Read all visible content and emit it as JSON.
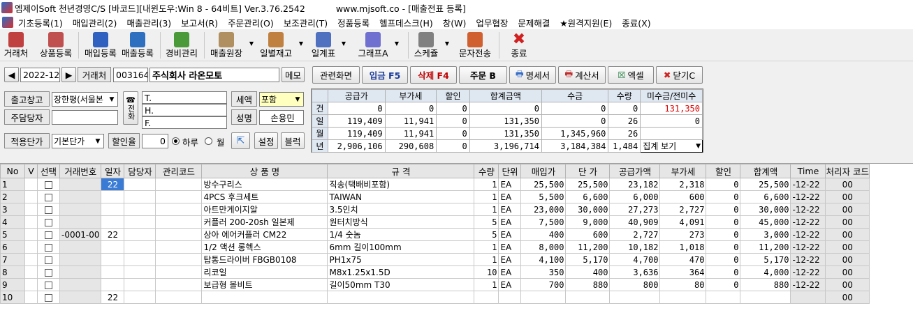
{
  "window": {
    "title": "엠제이Soft 천년경영C/S [바코드][내윈도우:Win 8 - 64비트] Ver.3.76.2542",
    "subtitle": "www.mjsoft.co - [매출전표 등록]"
  },
  "menu": [
    "기초등록(1)",
    "매입관리(2)",
    "매출관리(3)",
    "보고서(R)",
    "주문관리(O)",
    "보조관리(T)",
    "정품등록",
    "헬프데스크(H)",
    "창(W)",
    "업무협장",
    "문제해결",
    "★원격지원(E)",
    "종료(X)"
  ],
  "toolbar": [
    {
      "label": "거래처",
      "icon": "customer-icon",
      "color": "#c04040"
    },
    {
      "label": "상품등록",
      "icon": "product-icon",
      "color": "#c05050"
    },
    {
      "label": "매입등록",
      "icon": "purchase-icon",
      "color": "#3060c0"
    },
    {
      "label": "매출등록",
      "icon": "sales-icon",
      "color": "#2f6fc0"
    },
    {
      "label": "경비관리",
      "icon": "expense-icon",
      "color": "#4a9a3a"
    },
    {
      "label": "매출원장",
      "icon": "ledger-icon",
      "color": "#b09060"
    },
    {
      "label": "일별재고",
      "icon": "calendar-icon",
      "color": "#c08040"
    },
    {
      "label": "일계표",
      "icon": "daily-report-icon",
      "color": "#5070c0"
    },
    {
      "label": "그래프A",
      "icon": "graph-icon",
      "color": "#7070d0"
    },
    {
      "label": "스케쥴",
      "icon": "schedule-icon",
      "color": "#808080"
    },
    {
      "label": "문자전송",
      "icon": "sms-icon",
      "color": "#d06030"
    },
    {
      "label": "종료",
      "icon": "exit-icon",
      "color": "#d02020"
    }
  ],
  "header": {
    "prev": "◀",
    "next": "▶",
    "period": "2022-12",
    "customer_label": "거래처",
    "customer_code": "003164",
    "customer_name": "주식회사 라온모토",
    "memo": "메모",
    "warehouse_label": "출고창고",
    "warehouse_value": "장한평(서울본",
    "manager_label": "주담당자",
    "manager_value": "",
    "phone_label": "전화",
    "phone_t": "T.",
    "phone_h": "H.",
    "phone_f": "F.",
    "tax_label": "세액",
    "tax_value": "포함",
    "name_label": "성명",
    "name_value": "손용민",
    "price_label": "적용단가",
    "price_value": "기본단가",
    "discount_label": "할인율",
    "discount_value": "0",
    "radio_day": "하루",
    "radio_month": "월",
    "settings": "설정",
    "block": "블럭"
  },
  "actions": {
    "related": "관련화면",
    "entry": "입금 F5",
    "delete": "삭제 F4",
    "order": "주문 B",
    "statement": "명세서",
    "invoice": "계산서",
    "excel": "엑셀",
    "close": "닫기C"
  },
  "summary": {
    "columns": [
      "",
      "공급가",
      "부가세",
      "할인",
      "합계금액",
      "수금",
      "수량",
      "미수금/전미수"
    ],
    "rows": [
      {
        "label": "건",
        "values": [
          "0",
          "0",
          "0",
          "0",
          "0",
          "0",
          "131,350"
        ]
      },
      {
        "label": "일",
        "values": [
          "119,409",
          "11,941",
          "0",
          "131,350",
          "0",
          "26",
          "0"
        ]
      },
      {
        "label": "월",
        "values": [
          "119,409",
          "11,941",
          "0",
          "131,350",
          "1,345,960",
          "26",
          ""
        ]
      },
      {
        "label": "년",
        "values": [
          "2,906,106",
          "290,608",
          "0",
          "3,196,714",
          "3,184,384",
          "1,484",
          ""
        ]
      }
    ],
    "view_option": "집계 보기",
    "red_color": "#e00000"
  },
  "grid": {
    "columns": [
      "No",
      "V",
      "선택",
      "거래번호",
      "일자",
      "담당자",
      "관리코드",
      "상 품 명",
      "규 격",
      "수량",
      "단위",
      "매입가",
      "단 가",
      "공급가액",
      "부가세",
      "할인",
      "합계액",
      "Time",
      "처리자 코드"
    ],
    "trade_no": "-0001-00",
    "rows": [
      {
        "no": "1",
        "day": "22",
        "name": "방수구리스",
        "spec": "직송(택배비포함)",
        "qty": "1",
        "unit": "EA",
        "cost": "25,500",
        "price": "25,500",
        "supply": "23,182",
        "vat": "2,318",
        "disc": "0",
        "total": "25,500",
        "time": "-12-22",
        "user": "00"
      },
      {
        "no": "2",
        "day": "",
        "name": "4PCS 후크세트",
        "spec": "TAIWAN",
        "qty": "1",
        "unit": "EA",
        "cost": "5,500",
        "price": "6,600",
        "supply": "6,000",
        "vat": "600",
        "disc": "0",
        "total": "6,600",
        "time": "-12-22",
        "user": "00"
      },
      {
        "no": "3",
        "day": "",
        "name": "아트만게이지알",
        "spec": "3.5인치",
        "qty": "1",
        "unit": "EA",
        "cost": "23,000",
        "price": "30,000",
        "supply": "27,273",
        "vat": "2,727",
        "disc": "0",
        "total": "30,000",
        "time": "-12-22",
        "user": "00"
      },
      {
        "no": "4",
        "day": "",
        "name": "커플러 200-20sh 일본제",
        "spec": "원터치방식",
        "qty": "5",
        "unit": "EA",
        "cost": "7,500",
        "price": "9,000",
        "supply": "40,909",
        "vat": "4,091",
        "disc": "0",
        "total": "45,000",
        "time": "-12-22",
        "user": "00"
      },
      {
        "no": "5",
        "day": "22",
        "name": "상아 에어커플러 CM22",
        "spec": "1/4 숫놈",
        "qty": "5",
        "unit": "EA",
        "cost": "400",
        "price": "600",
        "supply": "2,727",
        "vat": "273",
        "disc": "0",
        "total": "3,000",
        "time": "-12-22",
        "user": "00"
      },
      {
        "no": "6",
        "day": "",
        "name": "1/2 액션 롱헥스",
        "spec": "6mm 길이100mm",
        "qty": "1",
        "unit": "EA",
        "cost": "8,000",
        "price": "11,200",
        "supply": "10,182",
        "vat": "1,018",
        "disc": "0",
        "total": "11,200",
        "time": "-12-22",
        "user": "00"
      },
      {
        "no": "7",
        "day": "",
        "name": "탑통드라이버 FBGB0108",
        "spec": "PH1x75",
        "qty": "1",
        "unit": "EA",
        "cost": "4,100",
        "price": "5,170",
        "supply": "4,700",
        "vat": "470",
        "disc": "0",
        "total": "5,170",
        "time": "-12-22",
        "user": "00"
      },
      {
        "no": "8",
        "day": "",
        "name": "리코일",
        "spec": "M8x1.25x1.5D",
        "qty": "10",
        "unit": "EA",
        "cost": "350",
        "price": "400",
        "supply": "3,636",
        "vat": "364",
        "disc": "0",
        "total": "4,000",
        "time": "-12-22",
        "user": "00"
      },
      {
        "no": "9",
        "day": "",
        "name": "보급형 볼비트",
        "spec": "길이50mm T30",
        "qty": "1",
        "unit": "EA",
        "cost": "700",
        "price": "880",
        "supply": "800",
        "vat": "80",
        "disc": "0",
        "total": "880",
        "time": "-12-22",
        "user": "00"
      },
      {
        "no": "10",
        "day": "22",
        "name": "",
        "spec": "",
        "qty": "",
        "unit": "",
        "cost": "",
        "price": "",
        "supply": "",
        "vat": "",
        "disc": "",
        "total": "",
        "time": "",
        "user": "00"
      }
    ]
  }
}
